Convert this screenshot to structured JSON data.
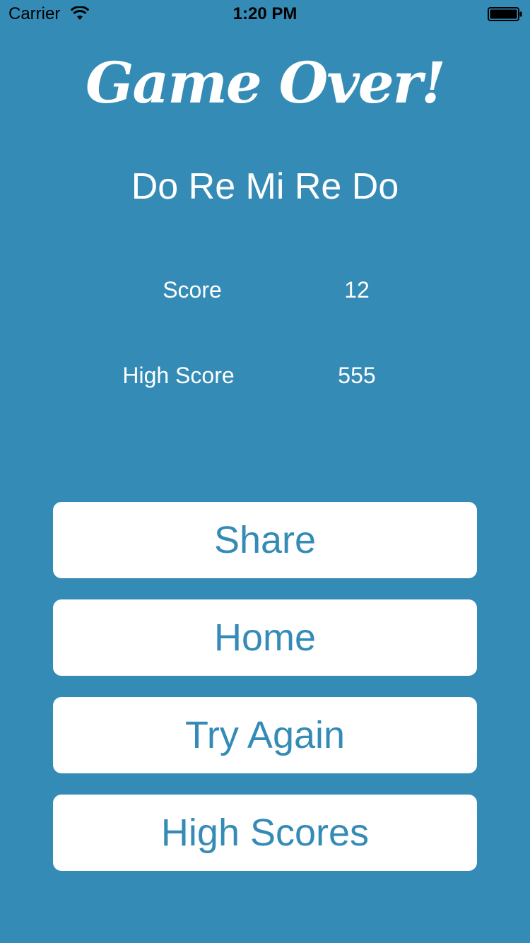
{
  "status_bar": {
    "carrier": "Carrier",
    "time": "1:20 PM",
    "wifi_icon": "wifi-icon",
    "battery_icon": "battery-icon"
  },
  "title": "Game Over!",
  "song": "Do Re Mi Re Do",
  "stats": {
    "score_label": "Score",
    "score_value": "12",
    "high_score_label": "High Score",
    "high_score_value": "555"
  },
  "buttons": {
    "share": "Share",
    "home": "Home",
    "try_again": "Try Again",
    "high_scores": "High Scores"
  },
  "colors": {
    "background": "#348bb6",
    "button_background": "#ffffff",
    "button_text": "#348bb6",
    "text": "#ffffff"
  }
}
